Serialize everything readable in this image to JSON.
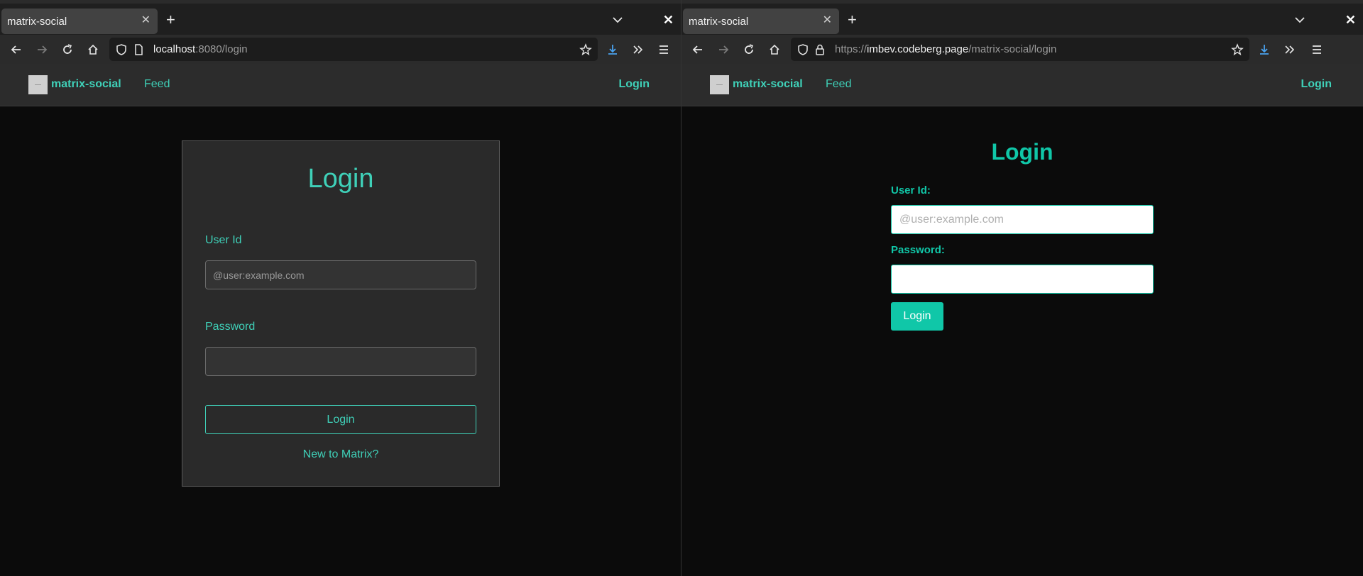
{
  "left": {
    "tab_title": "matrix-social",
    "url_host": "localhost",
    "url_rest": ":8080/login",
    "site": {
      "brand": "matrix-social",
      "feed": "Feed",
      "login": "Login"
    },
    "form": {
      "title": "Login",
      "user_label": "User Id",
      "user_placeholder": "@user:example.com",
      "password_label": "Password",
      "button": "Login",
      "link": "New to Matrix?"
    }
  },
  "right": {
    "tab_title": "matrix-social",
    "url_prefix": "https://",
    "url_host": "imbev.codeberg.page",
    "url_rest": "/matrix-social/login",
    "site": {
      "brand": "matrix-social",
      "feed": "Feed",
      "login": "Login"
    },
    "form": {
      "title": "Login",
      "user_label": "User Id:",
      "user_placeholder": "@user:example.com",
      "password_label": "Password:",
      "button": "Login"
    }
  },
  "colors": {
    "accent_dark": "#3fd0b8",
    "accent_plain": "#10c7a8",
    "download_icon": "#4aa3f0"
  },
  "icons": [
    "back-icon",
    "forward-icon",
    "reload-icon",
    "home-icon",
    "shield-icon",
    "page-icon",
    "lock-icon",
    "star-icon",
    "download-icon",
    "overflow-icon",
    "menu-icon",
    "plus-icon",
    "chevron-down-icon",
    "close-icon"
  ]
}
